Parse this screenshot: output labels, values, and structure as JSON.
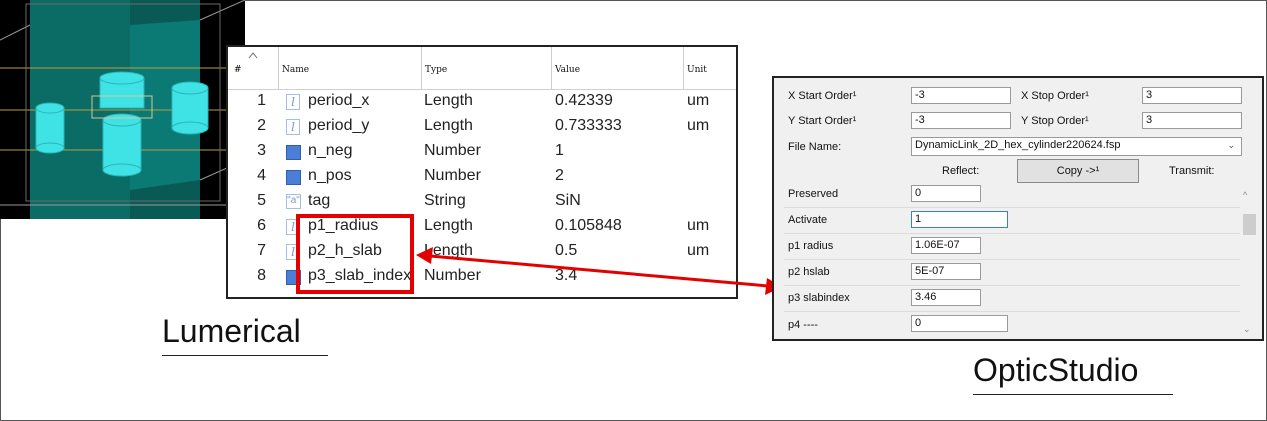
{
  "lumerical": {
    "label": "Lumerical",
    "headers": {
      "num": "#",
      "name": "Name",
      "type": "Type",
      "value": "Value",
      "unit": "Unit"
    },
    "rows": [
      {
        "num": "1",
        "icon": "length-icon",
        "name": "period_x",
        "type": "Length",
        "value": "0.42339",
        "unit": "um"
      },
      {
        "num": "2",
        "icon": "length-icon",
        "name": "period_y",
        "type": "Length",
        "value": "0.733333",
        "unit": "um"
      },
      {
        "num": "3",
        "icon": "number-icon",
        "name": "n_neg",
        "type": "Number",
        "value": "1",
        "unit": ""
      },
      {
        "num": "4",
        "icon": "number-icon",
        "name": "n_pos",
        "type": "Number",
        "value": "2",
        "unit": ""
      },
      {
        "num": "5",
        "icon": "string-icon",
        "name": "tag",
        "type": "String",
        "value": "SiN",
        "unit": ""
      },
      {
        "num": "6",
        "icon": "length-icon",
        "name": "p1_radius",
        "type": "Length",
        "value": "0.105848",
        "unit": "um"
      },
      {
        "num": "7",
        "icon": "length-icon",
        "name": "p2_h_slab",
        "type": "Length",
        "value": "0.5",
        "unit": "um"
      },
      {
        "num": "8",
        "icon": "number-icon",
        "name": "p3_slab_index",
        "type": "Number",
        "value": "3.4",
        "unit": ""
      }
    ]
  },
  "opticstudio": {
    "label": "OpticStudio",
    "x_start_label": "X Start Order¹",
    "x_start_value": "-3",
    "x_stop_label": "X Stop Order¹",
    "x_stop_value": "3",
    "y_start_label": "Y Start Order¹",
    "y_start_value": "-3",
    "y_stop_label": "Y Stop Order¹",
    "y_stop_value": "3",
    "file_name_label": "File Name:",
    "file_name_value": "DynamicLink_2D_hex_cylinder220624.fsp",
    "reflect_label": "Reflect:",
    "copy_button": "Copy ->¹",
    "transmit_label": "Transmit:",
    "params": [
      {
        "label": "Preserved",
        "value": "0"
      },
      {
        "label": "Activate",
        "value": "1"
      },
      {
        "label": "p1 radius",
        "value": "1.06E-07"
      },
      {
        "label": "p2 hslab",
        "value": "5E-07"
      },
      {
        "label": "p3 slabindex",
        "value": "3.46"
      },
      {
        "label": "p4 ----",
        "value": "0"
      }
    ]
  },
  "colors": {
    "highlight": "#e30000",
    "cylinder": "#3fe3e6",
    "slab": "#0f8f8a"
  }
}
